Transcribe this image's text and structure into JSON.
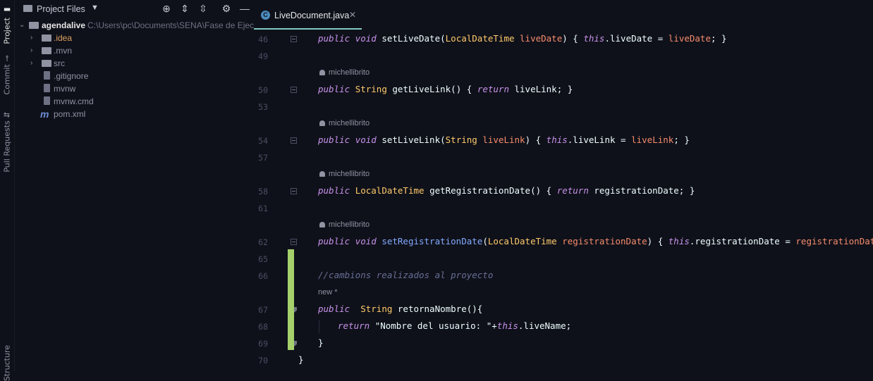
{
  "toolstrip": {
    "project_label": "Project",
    "commit_label": "Commit",
    "pull_requests_label": "Pull Requests",
    "structure_label": "Structure"
  },
  "project_panel": {
    "title": "Project Files",
    "root": {
      "name": "agendalive",
      "path": "C:\\Users\\pc\\Documents\\SENA\\Fase de Ejecuc"
    },
    "items": [
      {
        "name": ".idea",
        "type": "folder",
        "color": "#e0a060"
      },
      {
        "name": ".mvn",
        "type": "folder",
        "color": "#8f93a2"
      },
      {
        "name": "src",
        "type": "folder",
        "color": "#8f93a2"
      },
      {
        "name": ".gitignore",
        "type": "file",
        "color": "#8f93a2"
      },
      {
        "name": "mvnw",
        "type": "file",
        "color": "#8f93a2"
      },
      {
        "name": "mvnw.cmd",
        "type": "file",
        "color": "#8f93a2"
      },
      {
        "name": "pom.xml",
        "type": "maven",
        "color": "#8f93a2"
      }
    ]
  },
  "editor": {
    "tab": {
      "name": "LiveDocument.java",
      "icon": "C"
    },
    "author": "michellibrito",
    "new_hint": "new *",
    "line_numbers": [
      "46",
      "49",
      "50",
      "53",
      "54",
      "57",
      "58",
      "61",
      "62",
      "65",
      "66",
      "67",
      "68",
      "69",
      "70"
    ],
    "lines": {
      "l46": {
        "kw1": "public",
        "kw2": "void",
        "fn": "setLiveDate",
        "p1": "(",
        "ty": "LocalDateTime",
        "pa": "liveDate",
        "p2": ") { ",
        "kw3": "this",
        "rest": ".liveDate = ",
        "pa2": "liveDate",
        "end": "; }"
      },
      "l50": {
        "kw1": "public",
        "ty": "String",
        "fn": "getLiveLink",
        "p1": "() { ",
        "kw2": "return",
        "rest": " liveLink; }"
      },
      "l54": {
        "kw1": "public",
        "kw2": "void",
        "fn": "setLiveLink",
        "p1": "(",
        "ty": "String",
        "pa": "liveLink",
        "p2": ") { ",
        "kw3": "this",
        "rest": ".liveLink = ",
        "pa2": "liveLink",
        "end": "; }"
      },
      "l58": {
        "kw1": "public",
        "ty": "LocalDateTime",
        "fn": "getRegistrationDate",
        "p1": "() { ",
        "kw2": "return",
        "rest": " registrationDate; }"
      },
      "l62": {
        "kw1": "public",
        "kw2": "void",
        "fn": "setRegistrationDate",
        "p1": "(",
        "ty": "LocalDateTime",
        "pa": "registrationDate",
        "p2": ") { ",
        "kw3": "this",
        "rest": ".registrationDate = ",
        "pa2": "registrationDate",
        "end": "; }"
      },
      "l66": {
        "comment": "//cambions realizados al proyecto"
      },
      "l67": {
        "kw1": "public",
        "ty": "String",
        "fn": "retornaNombre",
        "p1": "(){"
      },
      "l68": {
        "kw1": "return",
        "str": "\"Nombre del usuario: \"",
        "op": "+",
        "kw2": "this",
        "rest": ".liveName;"
      },
      "l69": {
        "text": "}"
      },
      "l70": {
        "text": "}"
      }
    }
  },
  "colors": {
    "background": "#0f111a",
    "accent": "#80cbc4",
    "keyword": "#c792ea",
    "type": "#ffcb6b",
    "function": "#82aaff",
    "parameter": "#f78c6c",
    "comment": "#676e95",
    "string": "#c3e88d",
    "change_marker": "#a6d06b"
  }
}
